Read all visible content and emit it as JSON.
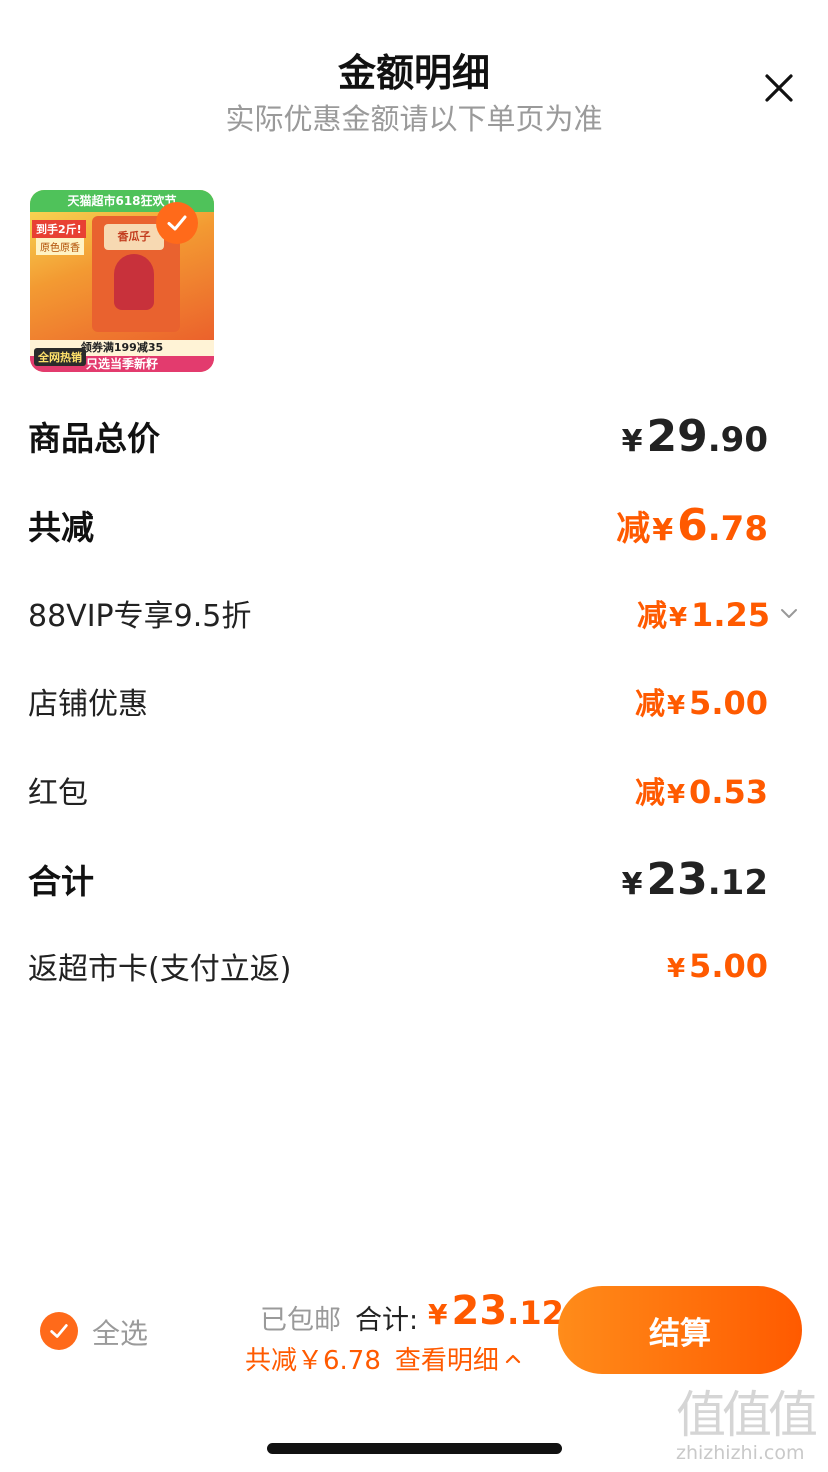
{
  "header": {
    "title": "金额明细",
    "subtitle": "实际优惠金额请以下单页为准"
  },
  "product": {
    "image_icon": "product-sunflower-seeds-thumbnail",
    "banner_top": "天猫超市618狂欢节",
    "tag_left": "到手2斤!",
    "tag_left2": "原色原香",
    "bag_text": "香瓜子",
    "promo": "领券满199减35",
    "banner_bottom": "只选当季新籽",
    "hot_tag": "全网热销"
  },
  "summary": {
    "subtotal": {
      "label": "商品总价",
      "yen": "¥",
      "int": "29",
      "dec": ".90"
    },
    "total_discount": {
      "label": "共减",
      "prefix": "减",
      "yen": "¥",
      "int": "6",
      "dec": ".78"
    },
    "discounts": [
      {
        "label": "88VIP专享9.5折",
        "prefix": "减",
        "yen": "¥",
        "amount": "1.25",
        "expandable": true
      },
      {
        "label": "店铺优惠",
        "prefix": "减",
        "yen": "¥",
        "amount": "5.00"
      },
      {
        "label": "红包",
        "prefix": "减",
        "yen": "¥",
        "amount": "0.53"
      }
    ],
    "total": {
      "label": "合计",
      "yen": "¥",
      "int": "23",
      "dec": ".12"
    },
    "cashback": {
      "label": "返超市卡(支付立返)",
      "yen": "¥",
      "amount": "5.00"
    }
  },
  "bottom_bar": {
    "select_all": "全选",
    "shipping": "已包邮",
    "total_label": "合计:",
    "total_yen": "¥",
    "total_int": "23",
    "total_dec": ".12",
    "reduce_text": "共减￥6.78",
    "details_link": "查看明细",
    "checkout_label": "结算"
  },
  "watermark": {
    "glyphs": "值值值",
    "text": "zhizhizhi.com"
  },
  "colors": {
    "accent": "#ff5a00",
    "accent_light": "#ff8c1a",
    "text": "#222222",
    "muted": "#9a9a9a"
  }
}
